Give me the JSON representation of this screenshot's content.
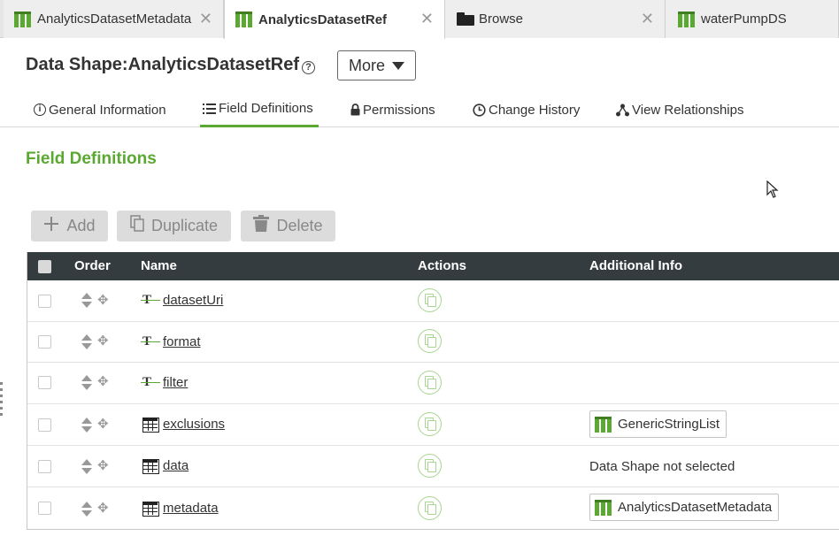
{
  "tabs": [
    {
      "label": "AnalyticsDatasetMetadata",
      "icon": "datashape-icon",
      "close": "✕"
    },
    {
      "label": "AnalyticsDatasetRef",
      "icon": "datashape-icon",
      "close": "✕",
      "active": true
    },
    {
      "label": "Browse",
      "icon": "folder-icon",
      "close": "✕"
    },
    {
      "label": "waterPumpDS",
      "icon": "datashape-icon"
    }
  ],
  "header": {
    "title": "Data Shape:AnalyticsDatasetRef",
    "help": "?",
    "more_label": "More"
  },
  "subtabs": [
    {
      "label": "General Information",
      "icon": "info-icon"
    },
    {
      "label": "Field Definitions",
      "icon": "list-icon",
      "active": true
    },
    {
      "label": "Permissions",
      "icon": "lock-icon"
    },
    {
      "label": "Change History",
      "icon": "clock-icon"
    },
    {
      "label": "View Relationships",
      "icon": "relationships-icon"
    }
  ],
  "section_title": "Field Definitions",
  "toolbar": {
    "add_label": "Add",
    "duplicate_label": "Duplicate",
    "delete_label": "Delete"
  },
  "table": {
    "columns": [
      "Order",
      "Name",
      "Actions",
      "Additional Info"
    ],
    "rows": [
      {
        "name": "datasetUri",
        "type_icon": "string-type-icon",
        "info": ""
      },
      {
        "name": "format",
        "type_icon": "string-type-icon",
        "info": ""
      },
      {
        "name": "filter",
        "type_icon": "string-type-icon",
        "info": ""
      },
      {
        "name": "exclusions",
        "type_icon": "infotable-type-icon",
        "info": "GenericStringList",
        "info_kind": "chip"
      },
      {
        "name": "data",
        "type_icon": "infotable-type-icon",
        "info": "Data Shape not selected",
        "info_kind": "text"
      },
      {
        "name": "metadata",
        "type_icon": "infotable-type-icon",
        "info": "AnalyticsDatasetMetadata",
        "info_kind": "chip"
      }
    ]
  },
  "colors": {
    "accent": "#5ba832",
    "header_bg": "#353c40",
    "tab_bg": "#e6e6e6"
  }
}
